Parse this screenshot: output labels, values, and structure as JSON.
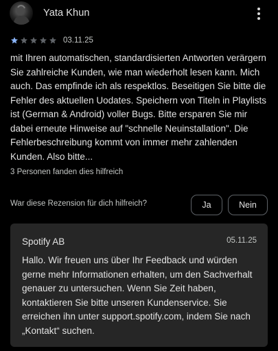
{
  "review": {
    "reviewer_name": "Yata Khun",
    "avatar_icon": "user-photo-avatar",
    "more_icon": "more-vertical-icon",
    "rating": 1,
    "rating_max": 5,
    "star_colors": {
      "filled": "#8ab4f8",
      "empty": "#5f6368"
    },
    "date": "03.11.25",
    "text": "mit Ihren automatischen, standardisierten Antworten verärgern Sie zahlreiche Kunden, wie man wiederholt lesen kann. Mich auch. Das empfinde ich als respektlos. Beseitigen Sie bitte die Fehler des aktuellen Uodates. Speichern von Titeln in Playlists ist (German & Android) voller Bugs. Bitte ersparen Sie mir dabei erneute Hinweise auf \"schnelle Neuinstallation\". Die Fehlerbeschreibung kommt von immer mehr zahlenden Kunden. Also bitte...",
    "helpful_count_text": "3 Personen fanden dies hilfreich"
  },
  "feedback": {
    "question": "War diese Rezension für dich hilfreich?",
    "yes_label": "Ja",
    "no_label": "Nein"
  },
  "developer_reply": {
    "name": "Spotify AB",
    "date": "05.11.25",
    "text": "Hallo. Wir freuen uns über Ihr Feedback und würden gerne mehr Informationen erhalten, um den Sachverhalt genauer zu untersuchen. Wenn Sie Zeit haben, kontaktieren Sie bitte unseren Kundenservice. Sie erreichen ihn unter support.spotify.com, indem Sie nach „Kontakt“ suchen."
  }
}
